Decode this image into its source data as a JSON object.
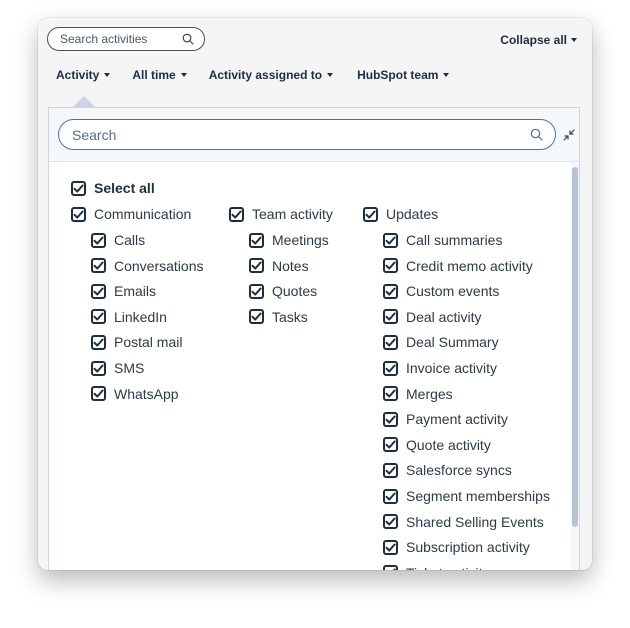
{
  "toolbar": {
    "search_placeholder": "Search activities",
    "collapse_all": "Collapse all",
    "filters": [
      "Activity",
      "All time",
      "Activity assigned to",
      "HubSpot team"
    ]
  },
  "panel": {
    "search_placeholder": "Search"
  },
  "checklist": {
    "select_all": "Select all",
    "groups": [
      {
        "label": "Communication",
        "items": [
          "Calls",
          "Conversations",
          "Emails",
          "LinkedIn",
          "Postal mail",
          "SMS",
          "WhatsApp"
        ]
      },
      {
        "label": "Team activity",
        "items": [
          "Meetings",
          "Notes",
          "Quotes",
          "Tasks"
        ]
      },
      {
        "label": "Updates",
        "items": [
          "Call summaries",
          "Credit memo activity",
          "Custom events",
          "Deal activity",
          "Deal Summary",
          "Invoice activity",
          "Merges",
          "Payment activity",
          "Quote activity",
          "Salesforce syncs",
          "Segment memberships",
          "Shared Selling Events",
          "Subscription activity",
          "Ticket activity"
        ]
      }
    ]
  },
  "icons": {
    "search": "search-icon",
    "caret": "caret-down-icon",
    "checkmark": "checkmark-icon",
    "shrink": "collapse-arrows-icon"
  },
  "colors": {
    "focus_border": "#3a76c4",
    "text_dark": "#1f2d3d",
    "panel_border": "#cbd6e2"
  }
}
